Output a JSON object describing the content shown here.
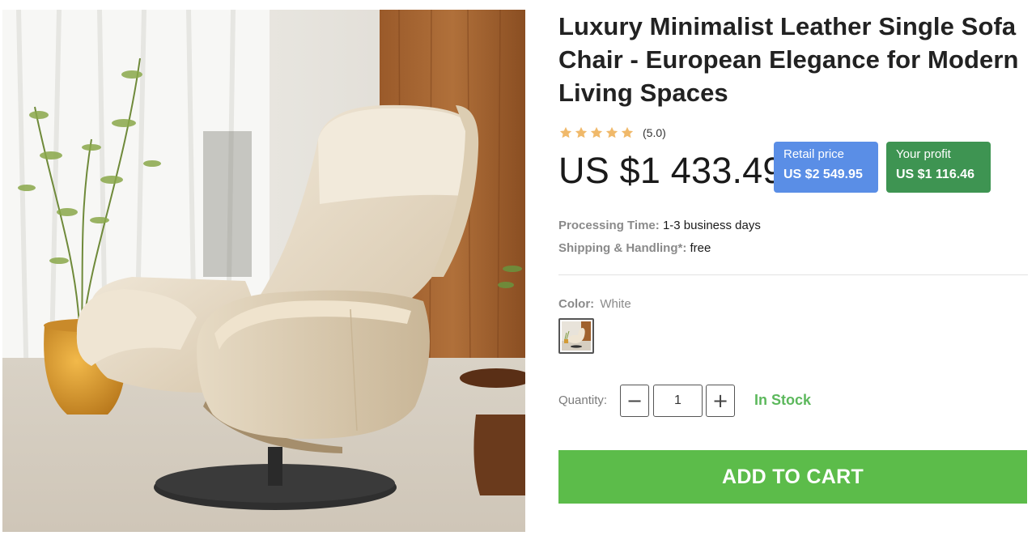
{
  "product": {
    "title": "Luxury Minimalist Leather Single Sofa Chair - European Elegance for Modern Living Spaces",
    "image_alt": "Cream leather reclining lounge chair with round black base",
    "rating": {
      "stars": 5,
      "text": "(5.0)",
      "star_color": "#f0b96a"
    },
    "price": "US $1 433.49",
    "retail": {
      "label": "Retail price",
      "value": "US $2 549.95",
      "color": "#5a8ee6"
    },
    "profit": {
      "label": "Your profit",
      "value": "US $1 116.46",
      "color": "#3e9452"
    },
    "processing": {
      "label": "Processing Time:",
      "value": "1-3 business days"
    },
    "shipping": {
      "label": "Shipping & Handling*:",
      "value": "free"
    },
    "color": {
      "label": "Color:",
      "value": "White"
    },
    "quantity": {
      "label": "Quantity:",
      "value": "1",
      "minus_icon": "minus-icon",
      "plus_icon": "plus-icon"
    },
    "stock_status": "In Stock",
    "stock_color": "#5cb85c",
    "add_to_cart": "ADD TO CART",
    "cart_color": "#5cbc4a"
  }
}
